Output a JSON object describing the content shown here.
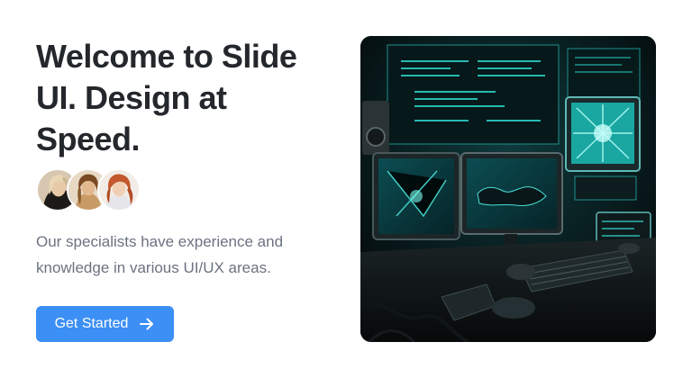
{
  "hero": {
    "title": "Welcome to Slide UI. Design at Speed.",
    "description": "Our specialists have experience and knowledge in various UI/UX areas.",
    "cta_label": "Get Started",
    "cta_icon": "arrow-right-icon"
  },
  "avatars": [
    "avatar-photo",
    "avatar-photo",
    "avatar-photo"
  ],
  "image": {
    "icon": "computer-workstation-image"
  },
  "colors": {
    "accent": "#3b8ff5",
    "heading": "#24272b",
    "body_text": "#6b7280",
    "image_glow": "#2fe3d6"
  }
}
